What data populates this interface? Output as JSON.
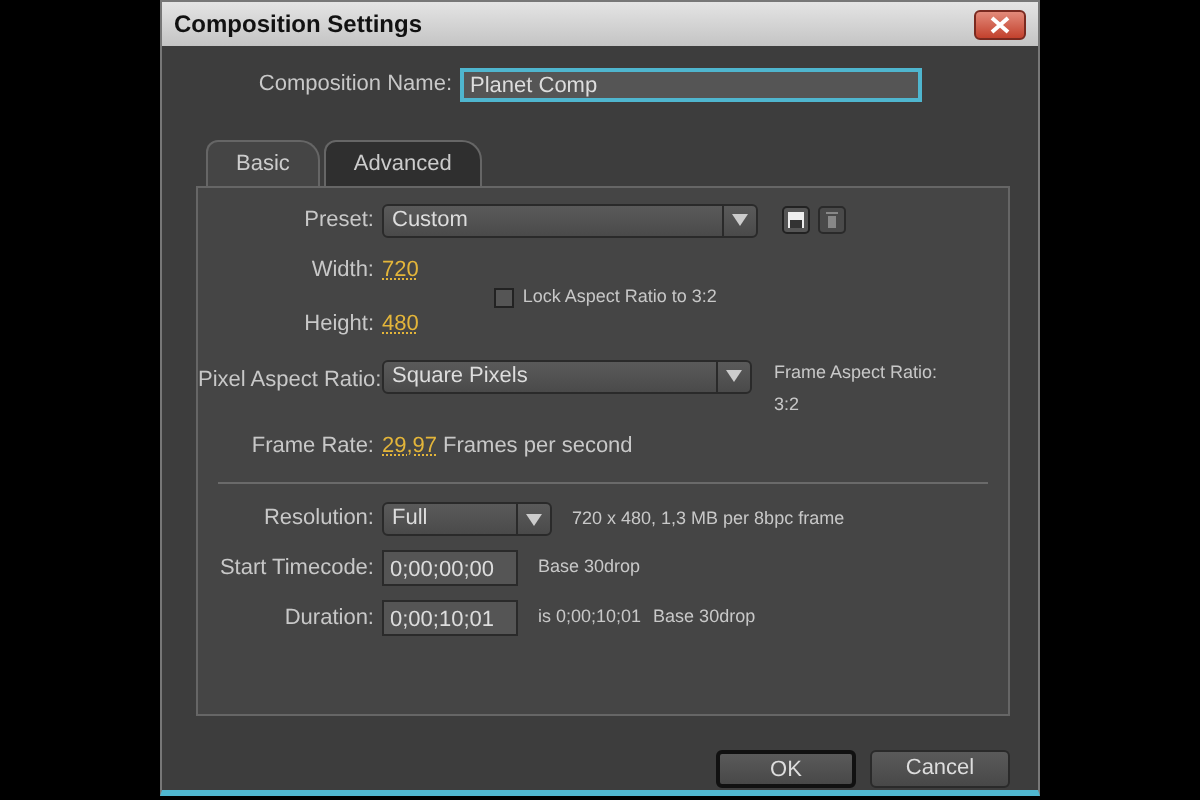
{
  "window": {
    "title": "Composition Settings"
  },
  "composition_name": {
    "label": "Composition Name:",
    "value": "Planet Comp",
    "focused": true
  },
  "tabs": [
    {
      "label": "Basic",
      "selected": true
    },
    {
      "label": "Advanced",
      "selected": false
    }
  ],
  "basic": {
    "preset": {
      "label": "Preset:",
      "value": "Custom"
    },
    "width": {
      "label": "Width:",
      "value": "720"
    },
    "height": {
      "label": "Height:",
      "value": "480"
    },
    "lock_aspect": {
      "label": "Lock Aspect Ratio to 3:2",
      "checked": false
    },
    "pixel_aspect": {
      "label": "Pixel Aspect Ratio:",
      "value": "Square Pixels"
    },
    "frame_aspect": {
      "label": "Frame Aspect Ratio:",
      "value": "3:2"
    },
    "frame_rate": {
      "label": "Frame Rate:",
      "value": "29,97",
      "unit": "Frames per second"
    },
    "resolution": {
      "label": "Resolution:",
      "value": "Full",
      "info": "720 x 480, 1,3 MB per 8bpc frame"
    },
    "start_timecode": {
      "label": "Start Timecode:",
      "value": "0;00;00;00",
      "notes": [
        "Base 30drop"
      ]
    },
    "duration": {
      "label": "Duration:",
      "value": "0;00;10;01",
      "notes": [
        "is 0;00;10;01",
        "Base 30drop"
      ]
    }
  },
  "buttons": [
    {
      "label": "OK",
      "default": true
    },
    {
      "label": "Cancel",
      "default": false
    }
  ]
}
